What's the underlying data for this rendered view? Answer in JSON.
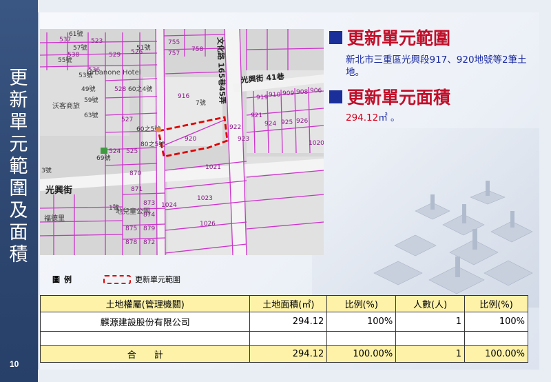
{
  "side_title": "更新單元範圍及面積",
  "page_number": "10",
  "section1": {
    "title": "更新單元範圍",
    "description": "新北市三重區光興段917、920地號等2筆土地。"
  },
  "section2": {
    "title": "更新單元面積",
    "area_value": "294.12",
    "area_unit": "㎡ 。"
  },
  "map": {
    "street_main": "光興街",
    "street_lane": "光興街 41巷",
    "road_vertical": "文化路 165巷45弄",
    "hotel": "Urbanone Hotel",
    "shop": "沃客商旅",
    "village": "福德里",
    "park": "地兒童公園",
    "parcels": [
      "537",
      "538",
      "523",
      "529",
      "526",
      "755",
      "757",
      "758",
      "536",
      "528",
      "527",
      "525",
      "524",
      "870",
      "871",
      "873",
      "874",
      "879",
      "875",
      "878",
      "872",
      "916",
      "920",
      "922",
      "923",
      "1020",
      "1021",
      "1023",
      "1024",
      "1026",
      "919",
      "910",
      "909",
      "908",
      "906",
      "921",
      "924",
      "925",
      "926"
    ],
    "house_numbers": [
      "61號",
      "57號",
      "55號",
      "51號",
      "53號",
      "49號",
      "59號",
      "63號",
      "60之4號",
      "60之5號",
      "80之5號",
      "7號",
      "69號",
      "3號",
      "1號"
    ]
  },
  "legend": {
    "title": "圖例",
    "item": "更新單元範圍"
  },
  "table": {
    "headers": [
      "土地權屬(管理機關)",
      "土地面積(㎡)",
      "比例(%)",
      "人數(人)",
      "比例(%)"
    ],
    "rows": [
      [
        "麒源建設股份有限公司",
        "294.12",
        "100%",
        "1",
        "100%"
      ]
    ],
    "total": [
      "合　　計",
      "294.12",
      "100.00%",
      "1",
      "100.00%"
    ]
  },
  "colors": {
    "heading_red": "#c0102a",
    "desc_blue": "#1a2aa0",
    "bullet_blue": "#1a2f9a",
    "band_navy": "#2c4670",
    "table_header": "#fdf2a8",
    "parcel_magenta": "#cc33cc",
    "boundary_red": "#e00000"
  }
}
